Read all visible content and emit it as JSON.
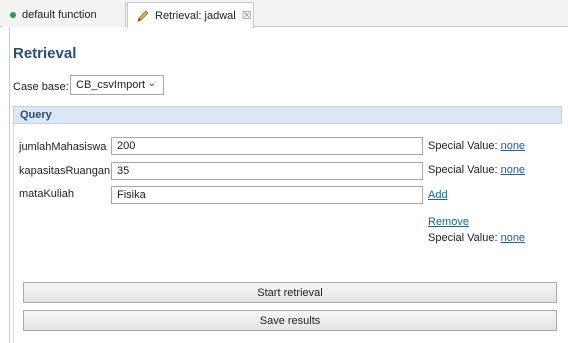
{
  "tabs": [
    {
      "label": "default function",
      "active": false,
      "icon": "green-dot-icon"
    },
    {
      "label": "Retrieval: jadwal",
      "active": true,
      "icon": "edit-pencil-icon",
      "close_glyph": "☒"
    }
  ],
  "title": "Retrieval",
  "case_base": {
    "label": "Case base:",
    "value": "CB_csvImport",
    "chevron": "⌄"
  },
  "query": {
    "header": "Query",
    "fields": [
      {
        "label": "jumlahMahasiswa",
        "value": "200",
        "special_label": "Special Value:",
        "special_link": "none"
      },
      {
        "label": "kapasitasRuangan",
        "value": "35",
        "special_label": "Special Value:",
        "special_link": "none"
      },
      {
        "label": "mataKuliah",
        "value": "Fisika",
        "add_link": "Add",
        "remove_link": "Remove",
        "special_label": "Special Value:",
        "special_link": "none"
      }
    ]
  },
  "buttons": {
    "start": "Start retrieval",
    "save": "Save results"
  },
  "colors": {
    "title": "#2a4d79",
    "link": "#1a5fb4",
    "query_header_bg": "#dbe7f5"
  }
}
